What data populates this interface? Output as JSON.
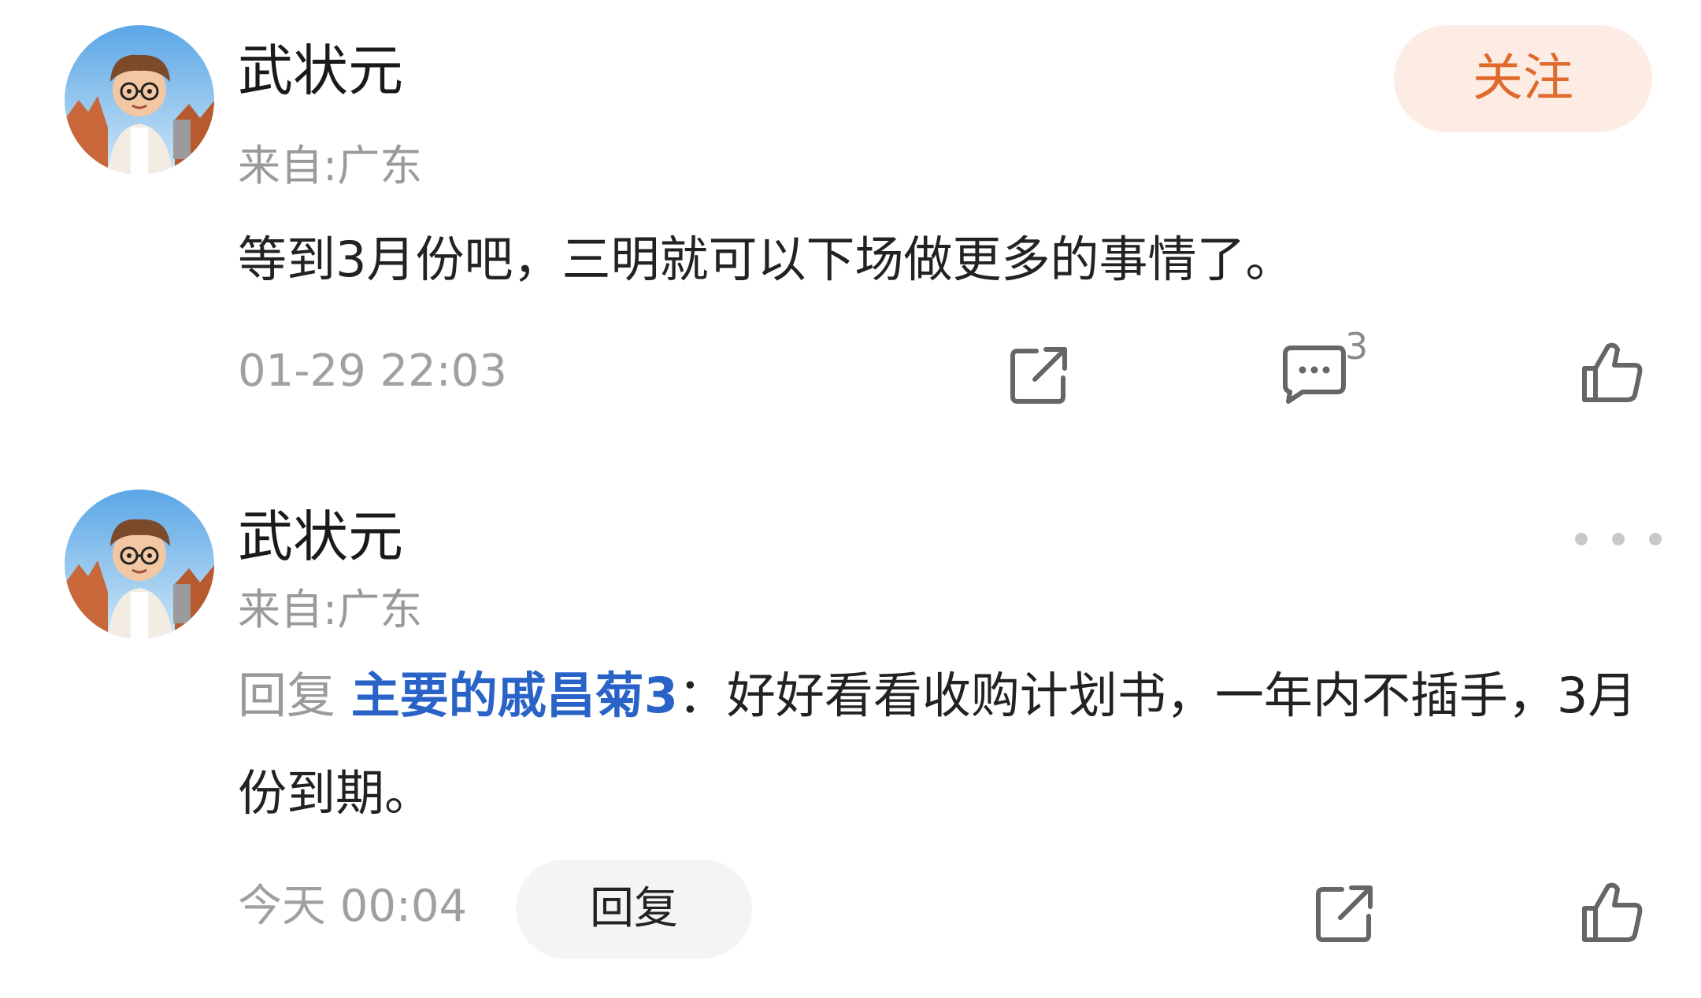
{
  "comments": [
    {
      "username": "武状元",
      "location": "来自:广东",
      "content": "等到3月份吧，三明就可以下场做更多的事情了。",
      "timestamp": "01-29 22:03",
      "follow_label": "关注",
      "reply_count": "3",
      "icons": [
        "share-icon",
        "comment-icon",
        "like-icon"
      ]
    },
    {
      "username": "武状元",
      "location": "来自:广东",
      "reply_prefix": "回复",
      "reply_target": "主要的戚昌菊3",
      "content": "：好好看看收购计划书，一年内不插手，3月份到期。",
      "timestamp": "今天 00:04",
      "reply_label": "回复",
      "icons": [
        "more-icon",
        "share-icon",
        "like-icon"
      ]
    }
  ],
  "colors": {
    "follow_text": "#e06a2c",
    "follow_bg": "#fcece3",
    "link": "#2a63c7",
    "muted": "#9a9a9a"
  }
}
